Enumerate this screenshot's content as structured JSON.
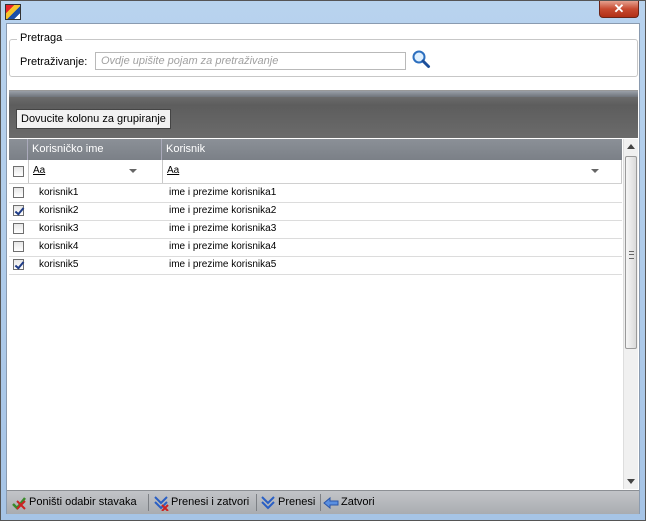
{
  "window": {
    "close_label": "✕"
  },
  "search": {
    "group_title": "Pretraga",
    "label": "Pretraživanje:",
    "value": "",
    "placeholder": "Ovdje upišite pojam za pretraživanje"
  },
  "grouping": {
    "button_label": "Dovucite kolonu za grupiranje"
  },
  "grid": {
    "columns": [
      "Korisničko ime",
      "Korisnik"
    ],
    "filters": [
      "Aa",
      "Aa"
    ],
    "rows": [
      {
        "username": "korisnik1",
        "name": "ime i prezime korisnika1",
        "checked": false
      },
      {
        "username": "korisnik2",
        "name": "ime i prezime korisnika2",
        "checked": true
      },
      {
        "username": "korisnik3",
        "name": "ime i prezime korisnika3",
        "checked": false
      },
      {
        "username": "korisnik4",
        "name": "ime i prezime korisnika4",
        "checked": false
      },
      {
        "username": "korisnik5",
        "name": "ime i prezime korisnika5",
        "checked": true
      }
    ]
  },
  "toolbar": {
    "deselect_label": "Poništi odabir stavaka",
    "transfer_close_label": "Prenesi i zatvori",
    "transfer_label": "Prenesi",
    "close_label": "Zatvori"
  },
  "icons": {
    "app": "app-logo-icon",
    "search": "magnifier-icon",
    "deselect": "uncheck-icon",
    "transfer_close": "transfer-close-icon",
    "transfer": "transfer-icon",
    "close": "arrow-left-icon"
  }
}
